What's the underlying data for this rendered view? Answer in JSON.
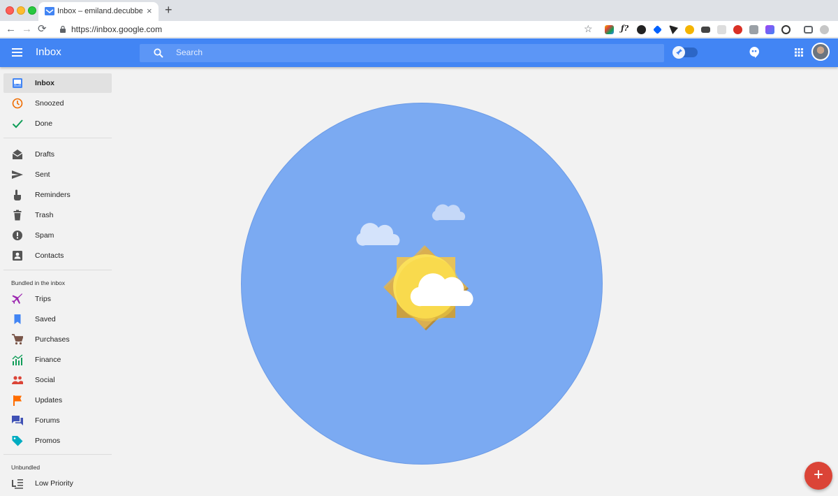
{
  "browser": {
    "tab_title": "Inbox – emiland.decubber@gm",
    "tab_close": "×",
    "new_tab": "+",
    "url": "https://inbox.google.com",
    "back": "←",
    "forward": "→",
    "reload": "⟳",
    "star": "☆"
  },
  "header": {
    "app_title": "Inbox",
    "search_placeholder": "Search",
    "accent_color": "#4285f4"
  },
  "sidebar": {
    "primary": [
      {
        "label": "Inbox",
        "icon": "inbox-icon",
        "active": true
      },
      {
        "label": "Snoozed",
        "icon": "clock-icon"
      },
      {
        "label": "Done",
        "icon": "check-icon"
      }
    ],
    "folders": [
      {
        "label": "Drafts",
        "icon": "envelope-open-icon"
      },
      {
        "label": "Sent",
        "icon": "send-icon"
      },
      {
        "label": "Reminders",
        "icon": "hand-pointer-icon"
      },
      {
        "label": "Trash",
        "icon": "trash-icon"
      },
      {
        "label": "Spam",
        "icon": "alert-icon"
      },
      {
        "label": "Contacts",
        "icon": "contact-icon"
      }
    ],
    "bundled_heading": "Bundled in the inbox",
    "bundles": [
      {
        "label": "Trips",
        "icon": "airplane-icon"
      },
      {
        "label": "Saved",
        "icon": "bookmark-icon"
      },
      {
        "label": "Purchases",
        "icon": "cart-icon"
      },
      {
        "label": "Finance",
        "icon": "chart-icon"
      },
      {
        "label": "Social",
        "icon": "people-icon"
      },
      {
        "label": "Updates",
        "icon": "flag-icon"
      },
      {
        "label": "Forums",
        "icon": "forum-icon"
      },
      {
        "label": "Promos",
        "icon": "tag-icon"
      }
    ],
    "unbundled_heading": "Unbundled",
    "unbundled": [
      {
        "label": "Low Priority",
        "icon": "low-priority-icon"
      }
    ]
  },
  "fab": {
    "label": "+",
    "color": "#db4437"
  }
}
